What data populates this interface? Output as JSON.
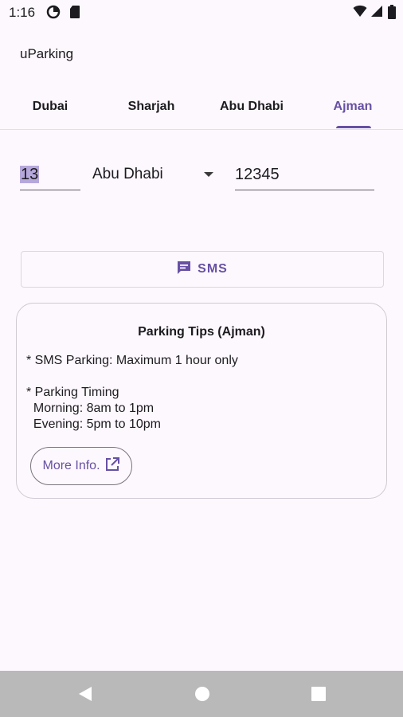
{
  "status_bar": {
    "time": "1:16",
    "icons": [
      "data-saver-icon",
      "sim-card-icon",
      "wifi-icon",
      "signal-icon",
      "battery-icon"
    ]
  },
  "app": {
    "title": "uParking"
  },
  "tabs": [
    {
      "label": "Dubai",
      "selected": false
    },
    {
      "label": "Sharjah",
      "selected": false
    },
    {
      "label": "Abu Dhabi",
      "selected": false
    },
    {
      "label": "Ajman",
      "selected": true
    }
  ],
  "form": {
    "plate_code": "13",
    "emirate": "Abu Dhabi",
    "plate_number": "12345"
  },
  "sms_button": {
    "label": "SMS",
    "icon": "sms-icon"
  },
  "tips": {
    "title": "Parking Tips (Ajman)",
    "lines": [
      "* SMS Parking: Maximum 1 hour only",
      "* Parking Timing",
      "  Morning: 8am to 1pm",
      "  Evening: 5pm to 10pm"
    ],
    "more_button": {
      "label": "More Info.",
      "icon": "open-in-new-icon"
    }
  },
  "nav": {
    "buttons": [
      "back-icon",
      "home-icon",
      "recents-icon"
    ]
  },
  "colors": {
    "accent": "#6750a4",
    "background": "#fdf8fd",
    "nav_bar": "#b9b9b9"
  }
}
